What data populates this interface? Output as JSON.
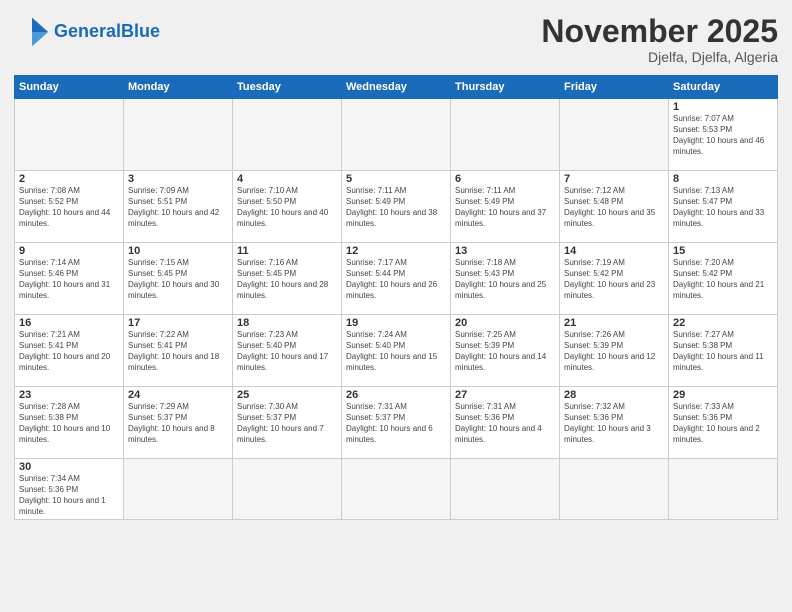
{
  "header": {
    "logo_general": "General",
    "logo_blue": "Blue",
    "title": "November 2025",
    "subtitle": "Djelfa, Djelfa, Algeria"
  },
  "weekdays": [
    "Sunday",
    "Monday",
    "Tuesday",
    "Wednesday",
    "Thursday",
    "Friday",
    "Saturday"
  ],
  "weeks": [
    [
      {
        "day": "",
        "info": ""
      },
      {
        "day": "",
        "info": ""
      },
      {
        "day": "",
        "info": ""
      },
      {
        "day": "",
        "info": ""
      },
      {
        "day": "",
        "info": ""
      },
      {
        "day": "",
        "info": ""
      },
      {
        "day": "1",
        "info": "Sunrise: 7:07 AM\nSunset: 5:53 PM\nDaylight: 10 hours and 46 minutes."
      }
    ],
    [
      {
        "day": "2",
        "info": "Sunrise: 7:08 AM\nSunset: 5:52 PM\nDaylight: 10 hours and 44 minutes."
      },
      {
        "day": "3",
        "info": "Sunrise: 7:09 AM\nSunset: 5:51 PM\nDaylight: 10 hours and 42 minutes."
      },
      {
        "day": "4",
        "info": "Sunrise: 7:10 AM\nSunset: 5:50 PM\nDaylight: 10 hours and 40 minutes."
      },
      {
        "day": "5",
        "info": "Sunrise: 7:11 AM\nSunset: 5:49 PM\nDaylight: 10 hours and 38 minutes."
      },
      {
        "day": "6",
        "info": "Sunrise: 7:11 AM\nSunset: 5:49 PM\nDaylight: 10 hours and 37 minutes."
      },
      {
        "day": "7",
        "info": "Sunrise: 7:12 AM\nSunset: 5:48 PM\nDaylight: 10 hours and 35 minutes."
      },
      {
        "day": "8",
        "info": "Sunrise: 7:13 AM\nSunset: 5:47 PM\nDaylight: 10 hours and 33 minutes."
      }
    ],
    [
      {
        "day": "9",
        "info": "Sunrise: 7:14 AM\nSunset: 5:46 PM\nDaylight: 10 hours and 31 minutes."
      },
      {
        "day": "10",
        "info": "Sunrise: 7:15 AM\nSunset: 5:45 PM\nDaylight: 10 hours and 30 minutes."
      },
      {
        "day": "11",
        "info": "Sunrise: 7:16 AM\nSunset: 5:45 PM\nDaylight: 10 hours and 28 minutes."
      },
      {
        "day": "12",
        "info": "Sunrise: 7:17 AM\nSunset: 5:44 PM\nDaylight: 10 hours and 26 minutes."
      },
      {
        "day": "13",
        "info": "Sunrise: 7:18 AM\nSunset: 5:43 PM\nDaylight: 10 hours and 25 minutes."
      },
      {
        "day": "14",
        "info": "Sunrise: 7:19 AM\nSunset: 5:42 PM\nDaylight: 10 hours and 23 minutes."
      },
      {
        "day": "15",
        "info": "Sunrise: 7:20 AM\nSunset: 5:42 PM\nDaylight: 10 hours and 21 minutes."
      }
    ],
    [
      {
        "day": "16",
        "info": "Sunrise: 7:21 AM\nSunset: 5:41 PM\nDaylight: 10 hours and 20 minutes."
      },
      {
        "day": "17",
        "info": "Sunrise: 7:22 AM\nSunset: 5:41 PM\nDaylight: 10 hours and 18 minutes."
      },
      {
        "day": "18",
        "info": "Sunrise: 7:23 AM\nSunset: 5:40 PM\nDaylight: 10 hours and 17 minutes."
      },
      {
        "day": "19",
        "info": "Sunrise: 7:24 AM\nSunset: 5:40 PM\nDaylight: 10 hours and 15 minutes."
      },
      {
        "day": "20",
        "info": "Sunrise: 7:25 AM\nSunset: 5:39 PM\nDaylight: 10 hours and 14 minutes."
      },
      {
        "day": "21",
        "info": "Sunrise: 7:26 AM\nSunset: 5:39 PM\nDaylight: 10 hours and 12 minutes."
      },
      {
        "day": "22",
        "info": "Sunrise: 7:27 AM\nSunset: 5:38 PM\nDaylight: 10 hours and 11 minutes."
      }
    ],
    [
      {
        "day": "23",
        "info": "Sunrise: 7:28 AM\nSunset: 5:38 PM\nDaylight: 10 hours and 10 minutes."
      },
      {
        "day": "24",
        "info": "Sunrise: 7:29 AM\nSunset: 5:37 PM\nDaylight: 10 hours and 8 minutes."
      },
      {
        "day": "25",
        "info": "Sunrise: 7:30 AM\nSunset: 5:37 PM\nDaylight: 10 hours and 7 minutes."
      },
      {
        "day": "26",
        "info": "Sunrise: 7:31 AM\nSunset: 5:37 PM\nDaylight: 10 hours and 6 minutes."
      },
      {
        "day": "27",
        "info": "Sunrise: 7:31 AM\nSunset: 5:36 PM\nDaylight: 10 hours and 4 minutes."
      },
      {
        "day": "28",
        "info": "Sunrise: 7:32 AM\nSunset: 5:36 PM\nDaylight: 10 hours and 3 minutes."
      },
      {
        "day": "29",
        "info": "Sunrise: 7:33 AM\nSunset: 5:36 PM\nDaylight: 10 hours and 2 minutes."
      }
    ],
    [
      {
        "day": "30",
        "info": "Sunrise: 7:34 AM\nSunset: 5:36 PM\nDaylight: 10 hours and 1 minute."
      },
      {
        "day": "",
        "info": ""
      },
      {
        "day": "",
        "info": ""
      },
      {
        "day": "",
        "info": ""
      },
      {
        "day": "",
        "info": ""
      },
      {
        "day": "",
        "info": ""
      },
      {
        "day": "",
        "info": ""
      }
    ]
  ]
}
